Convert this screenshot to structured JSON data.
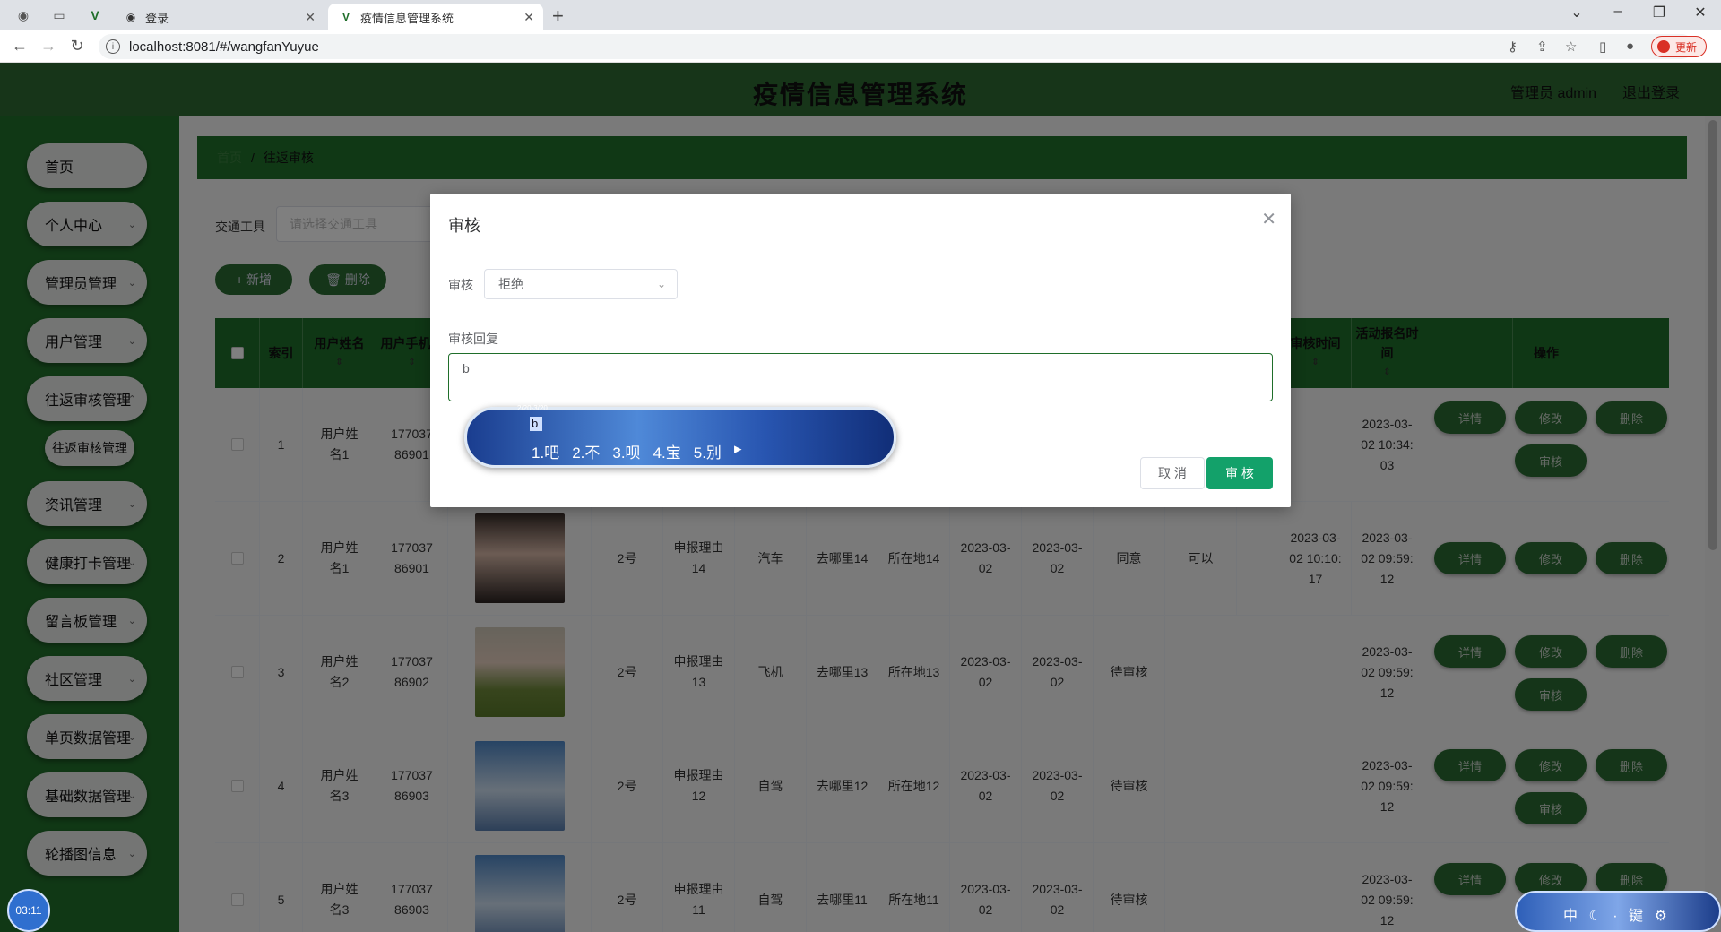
{
  "browser": {
    "tabs": [
      {
        "label": "登录"
      },
      {
        "label": "疫情信息管理系统",
        "active": true
      }
    ],
    "url": "localhost:8081/#/wangfanYuyue",
    "update_label": "更新"
  },
  "header": {
    "title": "疫情信息管理系统",
    "user": "管理员 admin",
    "logout": "退出登录"
  },
  "sidebar": {
    "items": [
      {
        "label": "首页"
      },
      {
        "label": "个人中心"
      },
      {
        "label": "管理员管理"
      },
      {
        "label": "用户管理"
      },
      {
        "label": "往返审核管理"
      },
      {
        "label": "往返审核管理",
        "sub": true
      },
      {
        "label": "资讯管理"
      },
      {
        "label": "健康打卡管理"
      },
      {
        "label": "留言板管理"
      },
      {
        "label": "社区管理"
      },
      {
        "label": "单页数据管理"
      },
      {
        "label": "基础数据管理"
      },
      {
        "label": "轮播图信息"
      }
    ],
    "timer": "03:11"
  },
  "breadcrumb": {
    "home": "首页",
    "current": "往返审核"
  },
  "search": {
    "label": "交通工具",
    "placeholder": "请选择交通工具"
  },
  "toolbar": {
    "add": "+ 新增",
    "delete": "🗑 删除"
  },
  "table": {
    "headers": [
      "索引",
      "用户姓名",
      "用户手机号",
      "审核时间",
      "活动报名时间",
      "操作"
    ],
    "rows": [
      {
        "index": "1",
        "name": "用户姓名1",
        "phone": "17703786901",
        "col_a": "",
        "col_b": "",
        "col_c": "",
        "col_d": "",
        "col_e": "",
        "col_f": "",
        "col_g": "",
        "col_h": "",
        "col_i": "",
        "audit_time": "",
        "apply_time": "2023-03-02 10:34:03",
        "ops": [
          "详情",
          "修改",
          "删除",
          "审核"
        ]
      },
      {
        "index": "2",
        "name": "用户姓名1",
        "phone": "17703786901",
        "col_a": "2号",
        "col_b": "申报理由14",
        "col_c": "汽车",
        "col_d": "去哪里14",
        "col_e": "所在地14",
        "col_f": "2023-03-02",
        "col_g": "2023-03-02",
        "col_h": "同意",
        "col_i": "可以",
        "audit_time": "2023-03-02 10:10:17",
        "apply_time": "2023-03-02 09:59:12",
        "ops": [
          "详情",
          "修改",
          "删除"
        ]
      },
      {
        "index": "3",
        "name": "用户姓名2",
        "phone": "17703786902",
        "col_a": "2号",
        "col_b": "申报理由13",
        "col_c": "飞机",
        "col_d": "去哪里13",
        "col_e": "所在地13",
        "col_f": "2023-03-02",
        "col_g": "2023-03-02",
        "col_h": "待审核",
        "col_i": "",
        "audit_time": "",
        "apply_time": "2023-03-02 09:59:12",
        "ops": [
          "详情",
          "修改",
          "删除",
          "审核"
        ]
      },
      {
        "index": "4",
        "name": "用户姓名3",
        "phone": "17703786903",
        "col_a": "2号",
        "col_b": "申报理由12",
        "col_c": "自驾",
        "col_d": "去哪里12",
        "col_e": "所在地12",
        "col_f": "2023-03-02",
        "col_g": "2023-03-02",
        "col_h": "待审核",
        "col_i": "",
        "audit_time": "",
        "apply_time": "2023-03-02 09:59:12",
        "ops": [
          "详情",
          "修改",
          "删除",
          "审核"
        ]
      },
      {
        "index": "5",
        "name": "用户姓名3",
        "phone": "17703786903",
        "col_a": "2号",
        "col_b": "申报理由11",
        "col_c": "自驾",
        "col_d": "去哪里11",
        "col_e": "所在地11",
        "col_f": "2023-03-02",
        "col_g": "2023-03-02",
        "col_h": "待审核",
        "col_i": "",
        "audit_time": "",
        "apply_time": "2023-03-02 09:59:12",
        "ops": [
          "详情",
          "修改",
          "删除"
        ]
      }
    ]
  },
  "dialog": {
    "title": "审核",
    "audit_label": "审核",
    "audit_value": "拒绝",
    "reply_label": "审核回复",
    "reply_value": "b",
    "cancel": "取 消",
    "submit": "审 核"
  },
  "ime": {
    "composition": "b",
    "candidates": [
      "1.吧",
      "2.不",
      "3.呗",
      "4.宝",
      "5.别"
    ],
    "tag": "2/20-3/20",
    "status": "中 ☾ · 键 ⚙"
  },
  "colors": {
    "primary_green": "#1f6e2a",
    "submit_green": "#13a16a"
  }
}
